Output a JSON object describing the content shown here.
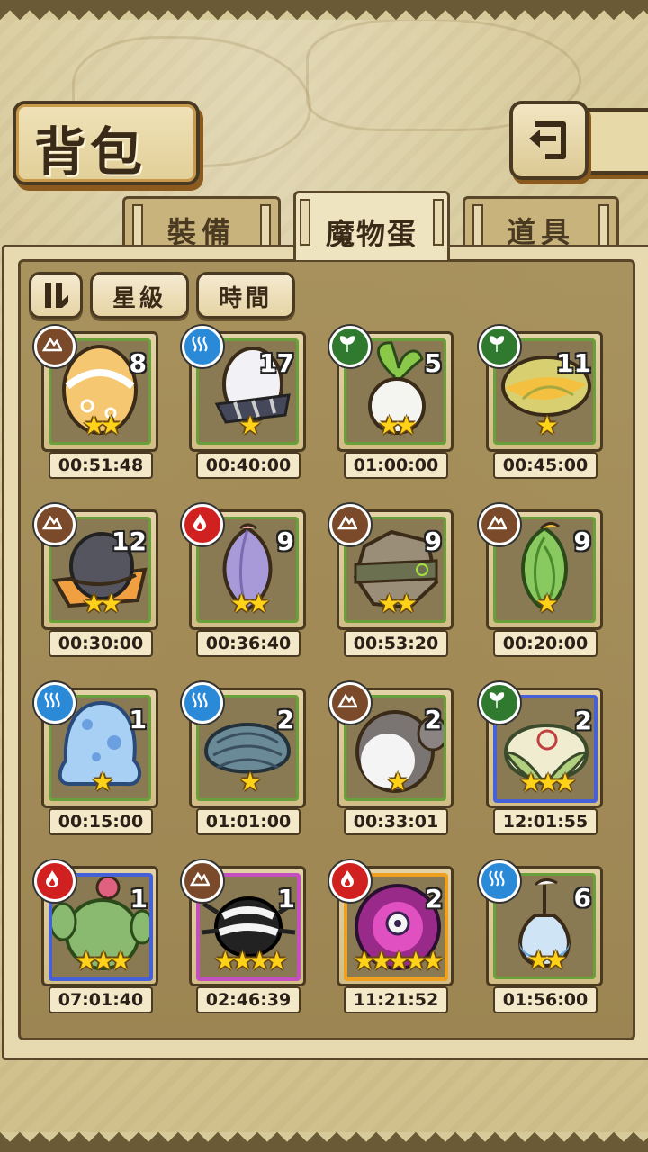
{
  "title": "背包",
  "tabs": [
    {
      "label": "裝備",
      "active": false
    },
    {
      "label": "魔物蛋",
      "active": true
    },
    {
      "label": "道具",
      "active": false
    }
  ],
  "sort_buttons": {
    "toggle_icon": "pause-bars-icon",
    "star": "星級",
    "time": "時間"
  },
  "colors": {
    "earth": "#7a4a2a",
    "water": "#2a8ad8",
    "wood": "#2f7a2f",
    "fire": "#d02020",
    "star": "#ffd21a"
  },
  "eggs": [
    {
      "element": "earth",
      "count": "8",
      "stars": "★★",
      "timer": "00:51:48",
      "rarity": 2,
      "art": "gold-swirl-egg"
    },
    {
      "element": "water",
      "count": "17",
      "stars": "★",
      "timer": "00:40:00",
      "rarity": 1,
      "art": "white-striped-egg"
    },
    {
      "element": "wood",
      "count": "5",
      "stars": "★★",
      "timer": "01:00:00",
      "rarity": 2,
      "art": "radish-egg"
    },
    {
      "element": "wood",
      "count": "11",
      "stars": "★",
      "timer": "00:45:00",
      "rarity": 1,
      "art": "leaf-egg"
    },
    {
      "element": "earth",
      "count": "12",
      "stars": "★★",
      "timer": "00:30:00",
      "rarity": 2,
      "art": "hat-egg"
    },
    {
      "element": "fire",
      "count": "9",
      "stars": "★★",
      "timer": "00:36:40",
      "rarity": 2,
      "art": "purple-bud-egg"
    },
    {
      "element": "earth",
      "count": "9",
      "stars": "★★",
      "timer": "00:53:20",
      "rarity": 2,
      "art": "rock-egg"
    },
    {
      "element": "earth",
      "count": "9",
      "stars": "★",
      "timer": "00:20:00",
      "rarity": 1,
      "art": "green-bud-egg"
    },
    {
      "element": "water",
      "count": "1",
      "stars": "★",
      "timer": "00:15:00",
      "rarity": 1,
      "art": "slime-egg"
    },
    {
      "element": "water",
      "count": "2",
      "stars": "★",
      "timer": "01:01:00",
      "rarity": 1,
      "art": "shell-egg"
    },
    {
      "element": "earth",
      "count": "2",
      "stars": "★",
      "timer": "00:33:01",
      "rarity": 1,
      "art": "koala-egg"
    },
    {
      "element": "wood",
      "count": "2",
      "stars": "★★★",
      "timer": "12:01:55",
      "rarity": 3,
      "art": "cocoon-egg"
    },
    {
      "element": "fire",
      "count": "1",
      "stars": "★★★",
      "timer": "07:01:40",
      "rarity": 3,
      "art": "cactus-egg"
    },
    {
      "element": "earth",
      "count": "1",
      "stars": "★★★★",
      "timer": "02:46:39",
      "rarity": 4,
      "art": "spider-egg"
    },
    {
      "element": "fire",
      "count": "2",
      "stars": "★★★★★",
      "timer": "11:21:52",
      "rarity": 5,
      "art": "orb-egg"
    },
    {
      "element": "water",
      "count": "6",
      "stars": "★★",
      "timer": "01:56:00",
      "rarity": 2,
      "art": "bulb-egg"
    }
  ]
}
